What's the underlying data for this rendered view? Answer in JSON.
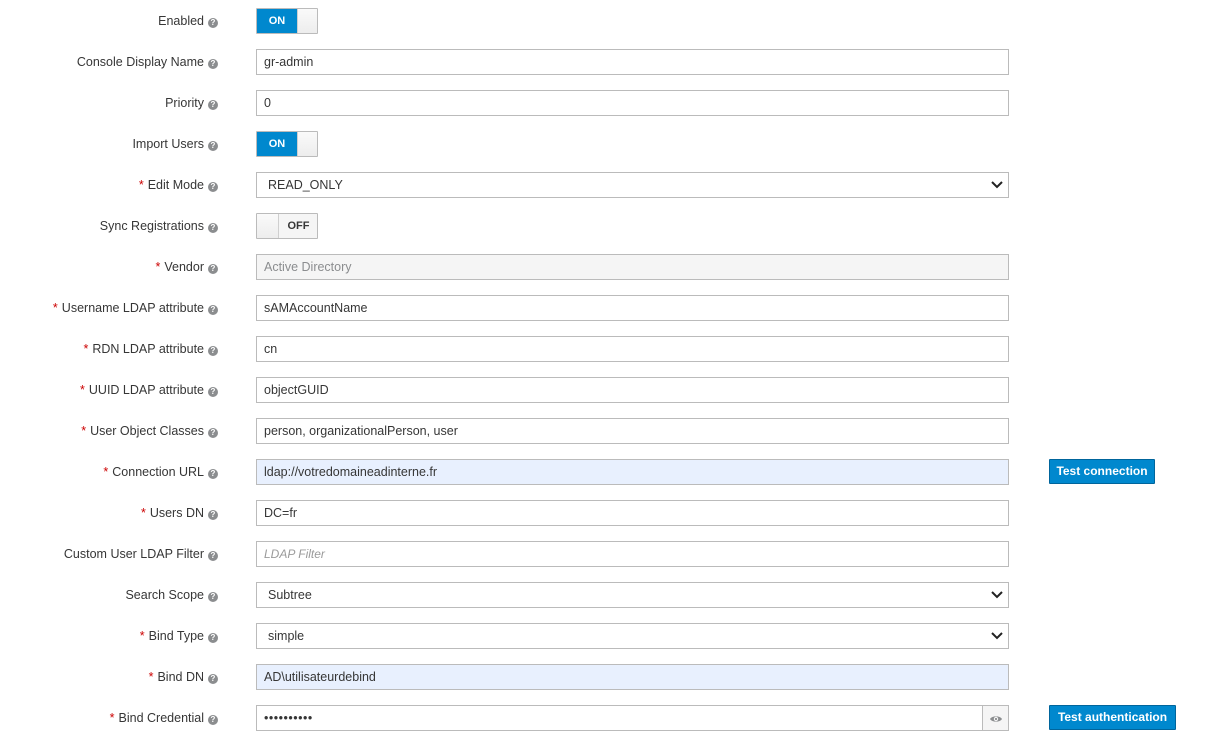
{
  "fields": {
    "enabled": {
      "label": "Enabled",
      "required": false,
      "state": "ON"
    },
    "console_display_name": {
      "label": "Console Display Name",
      "required": false,
      "value": "gr-admin"
    },
    "priority": {
      "label": "Priority",
      "required": false,
      "value": "0"
    },
    "import_users": {
      "label": "Import Users",
      "required": false,
      "state": "ON"
    },
    "edit_mode": {
      "label": "Edit Mode",
      "required": true,
      "value": "READ_ONLY"
    },
    "sync_registrations": {
      "label": "Sync Registrations",
      "required": false,
      "state": "OFF"
    },
    "vendor": {
      "label": "Vendor",
      "required": true,
      "value": "Active Directory"
    },
    "username_ldap_attribute": {
      "label": "Username LDAP attribute",
      "required": true,
      "value": "sAMAccountName"
    },
    "rdn_ldap_attribute": {
      "label": "RDN LDAP attribute",
      "required": true,
      "value": "cn"
    },
    "uuid_ldap_attribute": {
      "label": "UUID LDAP attribute",
      "required": true,
      "value": "objectGUID"
    },
    "user_object_classes": {
      "label": "User Object Classes",
      "required": true,
      "value": "person, organizationalPerson, user"
    },
    "connection_url": {
      "label": "Connection URL",
      "required": true,
      "value": "ldap://votredomaineadinterne.fr"
    },
    "users_dn": {
      "label": "Users DN",
      "required": true,
      "value": "DC=fr"
    },
    "custom_user_ldap_filter": {
      "label": "Custom User LDAP Filter",
      "required": false,
      "value": "",
      "placeholder": "LDAP Filter"
    },
    "search_scope": {
      "label": "Search Scope",
      "required": false,
      "value": "Subtree"
    },
    "bind_type": {
      "label": "Bind Type",
      "required": true,
      "value": "simple"
    },
    "bind_dn": {
      "label": "Bind DN",
      "required": true,
      "value": "AD\\utilisateurdebind"
    },
    "bind_credential": {
      "label": "Bind Credential",
      "required": true,
      "value": "••••••••••"
    }
  },
  "buttons": {
    "test_connection": "Test connection",
    "test_authentication": "Test authentication"
  },
  "icons": {
    "help": "help-icon",
    "show_password": "eye-icon",
    "select": "chevron-down-icon"
  },
  "colors": {
    "accent": "#0088ce",
    "required": "#cc0000",
    "autofill_bg": "#e8f0fe",
    "readonly_bg": "#f5f5f5"
  }
}
